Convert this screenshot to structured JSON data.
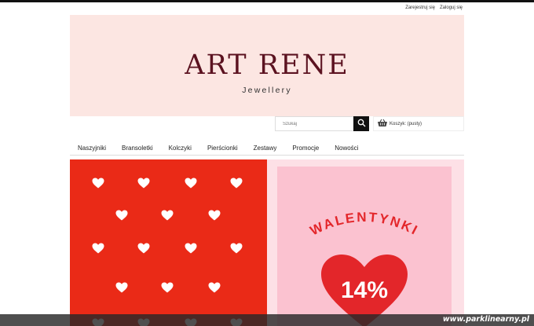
{
  "top_links": {
    "register": "Zarejestruj się",
    "login": "Zaloguj się"
  },
  "logo": {
    "title": "ART RENE",
    "subtitle": "Jewellery"
  },
  "search": {
    "placeholder": "Szukaj"
  },
  "cart": {
    "label": "Koszyk: (pusty)"
  },
  "nav": [
    "Naszyjniki",
    "Bransoletki",
    "Kolczyki",
    "Pierścionki",
    "Zestawy",
    "Promocje",
    "Nowości"
  ],
  "banner": {
    "heading": "WALENTYNKI",
    "discount": "14%"
  },
  "watermark": "www.parklinearny.pl",
  "colors": {
    "header_bg": "#fce6e2",
    "logo_color": "#5b1220",
    "banner_red": "#ea2a17",
    "card_pink": "#fbc2d0",
    "text_red": "#e3262a"
  }
}
